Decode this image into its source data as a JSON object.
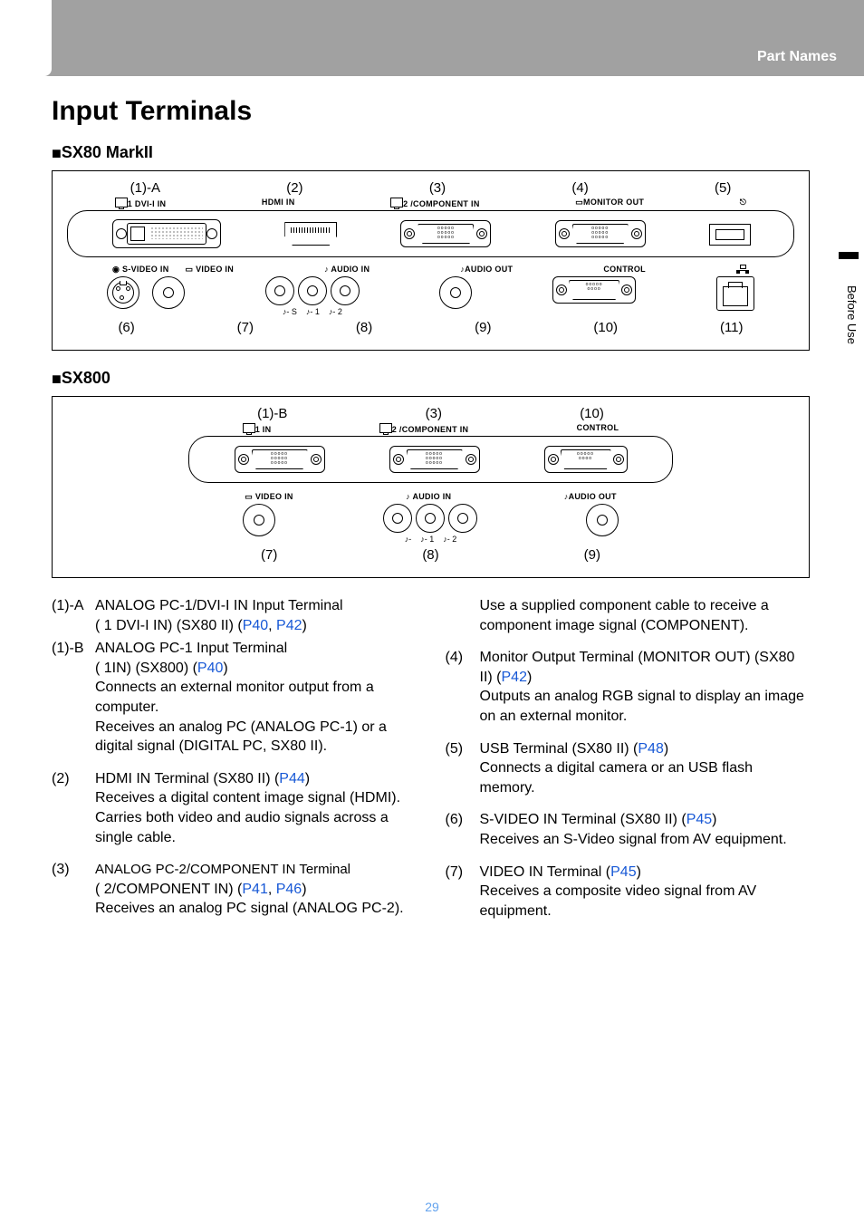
{
  "header": {
    "section": "Part Names"
  },
  "side_tab": "Before Use",
  "page_number": "29",
  "h1": "Input Terminals",
  "models": {
    "a": "SX80 MarkII",
    "b": "SX800"
  },
  "diagramA": {
    "top_callouts": [
      "(1)-A",
      "(2)",
      "(3)",
      "(4)",
      "(5)"
    ],
    "top_port_labels": [
      "1 DVI-I IN",
      "HDMI IN",
      "2 /COMPONENT IN",
      "MONITOR OUT",
      ""
    ],
    "mid_port_labels_left": [
      "S-VIDEO IN",
      "VIDEO IN"
    ],
    "mid_port_labels": [
      "AUDIO IN",
      "AUDIO OUT",
      "CONTROL",
      ""
    ],
    "bottom_callouts": [
      "(6)",
      "(7)",
      "(8)",
      "(9)",
      "(10)",
      "(11)"
    ],
    "audio_sub": [
      "♪- S",
      "♪- 1",
      "♪- 2"
    ]
  },
  "diagramB": {
    "top_callouts": [
      "(1)-B",
      "(3)",
      "(10)"
    ],
    "top_port_labels": [
      "1 IN",
      "2 /COMPONENT IN",
      "CONTROL"
    ],
    "mid_port_labels": [
      "VIDEO IN",
      "AUDIO IN",
      "AUDIO OUT"
    ],
    "bottom_callouts": [
      "(7)",
      "(8)",
      "(9)"
    ],
    "audio_sub": [
      "♪-",
      "♪- 1",
      "♪- 2"
    ]
  },
  "desc": {
    "i1a": {
      "num": "(1)-A",
      "title_a": "ANALOG PC-1/DVI-I IN Input Terminal",
      "title_b": "( 1 DVI-I IN) (SX80 II) (",
      "link1": "P40",
      "sep1": ", ",
      "link2": "P42",
      "close1": ")"
    },
    "i1b": {
      "num": "(1)-B",
      "title_a": "ANALOG PC-1 Input Terminal",
      "title_b": "( 1IN) (SX800) (",
      "link1": "P40",
      "close1": ")",
      "body1": "Connects an external monitor output from a computer.",
      "body2": "Receives an analog PC (ANALOG PC-1) or a digital signal (DIGITAL PC, SX80 II)."
    },
    "i2": {
      "num": "(2)",
      "title": "HDMI IN Terminal (SX80 II) (",
      "link1": "P44",
      "close1": ")",
      "body1": "Receives a digital content image signal (HDMI).",
      "body2": "Carries both video and audio signals across a single cable."
    },
    "i3": {
      "num": "(3)",
      "title": "ANALOG PC-2/COMPONENT IN Terminal",
      "title_b": "( 2/COMPONENT IN) (",
      "link1": "P41",
      "sep1": ", ",
      "link2": "P46",
      "close1": ")",
      "body1": "Receives an analog PC signal (ANALOG PC-2).",
      "body2": "Use a supplied component cable to receive a component image signal (COMPONENT)."
    },
    "i4": {
      "num": "(4)",
      "title": "Monitor Output Terminal (MONITOR OUT) (SX80 II) (",
      "link1": "P42",
      "close1": ")",
      "body1": "Outputs an analog RGB signal to display an image on an external monitor."
    },
    "i5": {
      "num": "(5)",
      "title": "USB Terminal (SX80 II) (",
      "link1": "P48",
      "close1": ")",
      "body1": "Connects a digital camera or an USB flash memory."
    },
    "i6": {
      "num": "(6)",
      "title": "S-VIDEO IN Terminal (SX80 II) (",
      "link1": "P45",
      "close1": ")",
      "body1": "Receives an S-Video signal from AV equipment."
    },
    "i7": {
      "num": "(7)",
      "title": "VIDEO IN Terminal (",
      "link1": "P45",
      "close1": ")",
      "body1": "Receives a composite video signal from AV equipment."
    }
  }
}
